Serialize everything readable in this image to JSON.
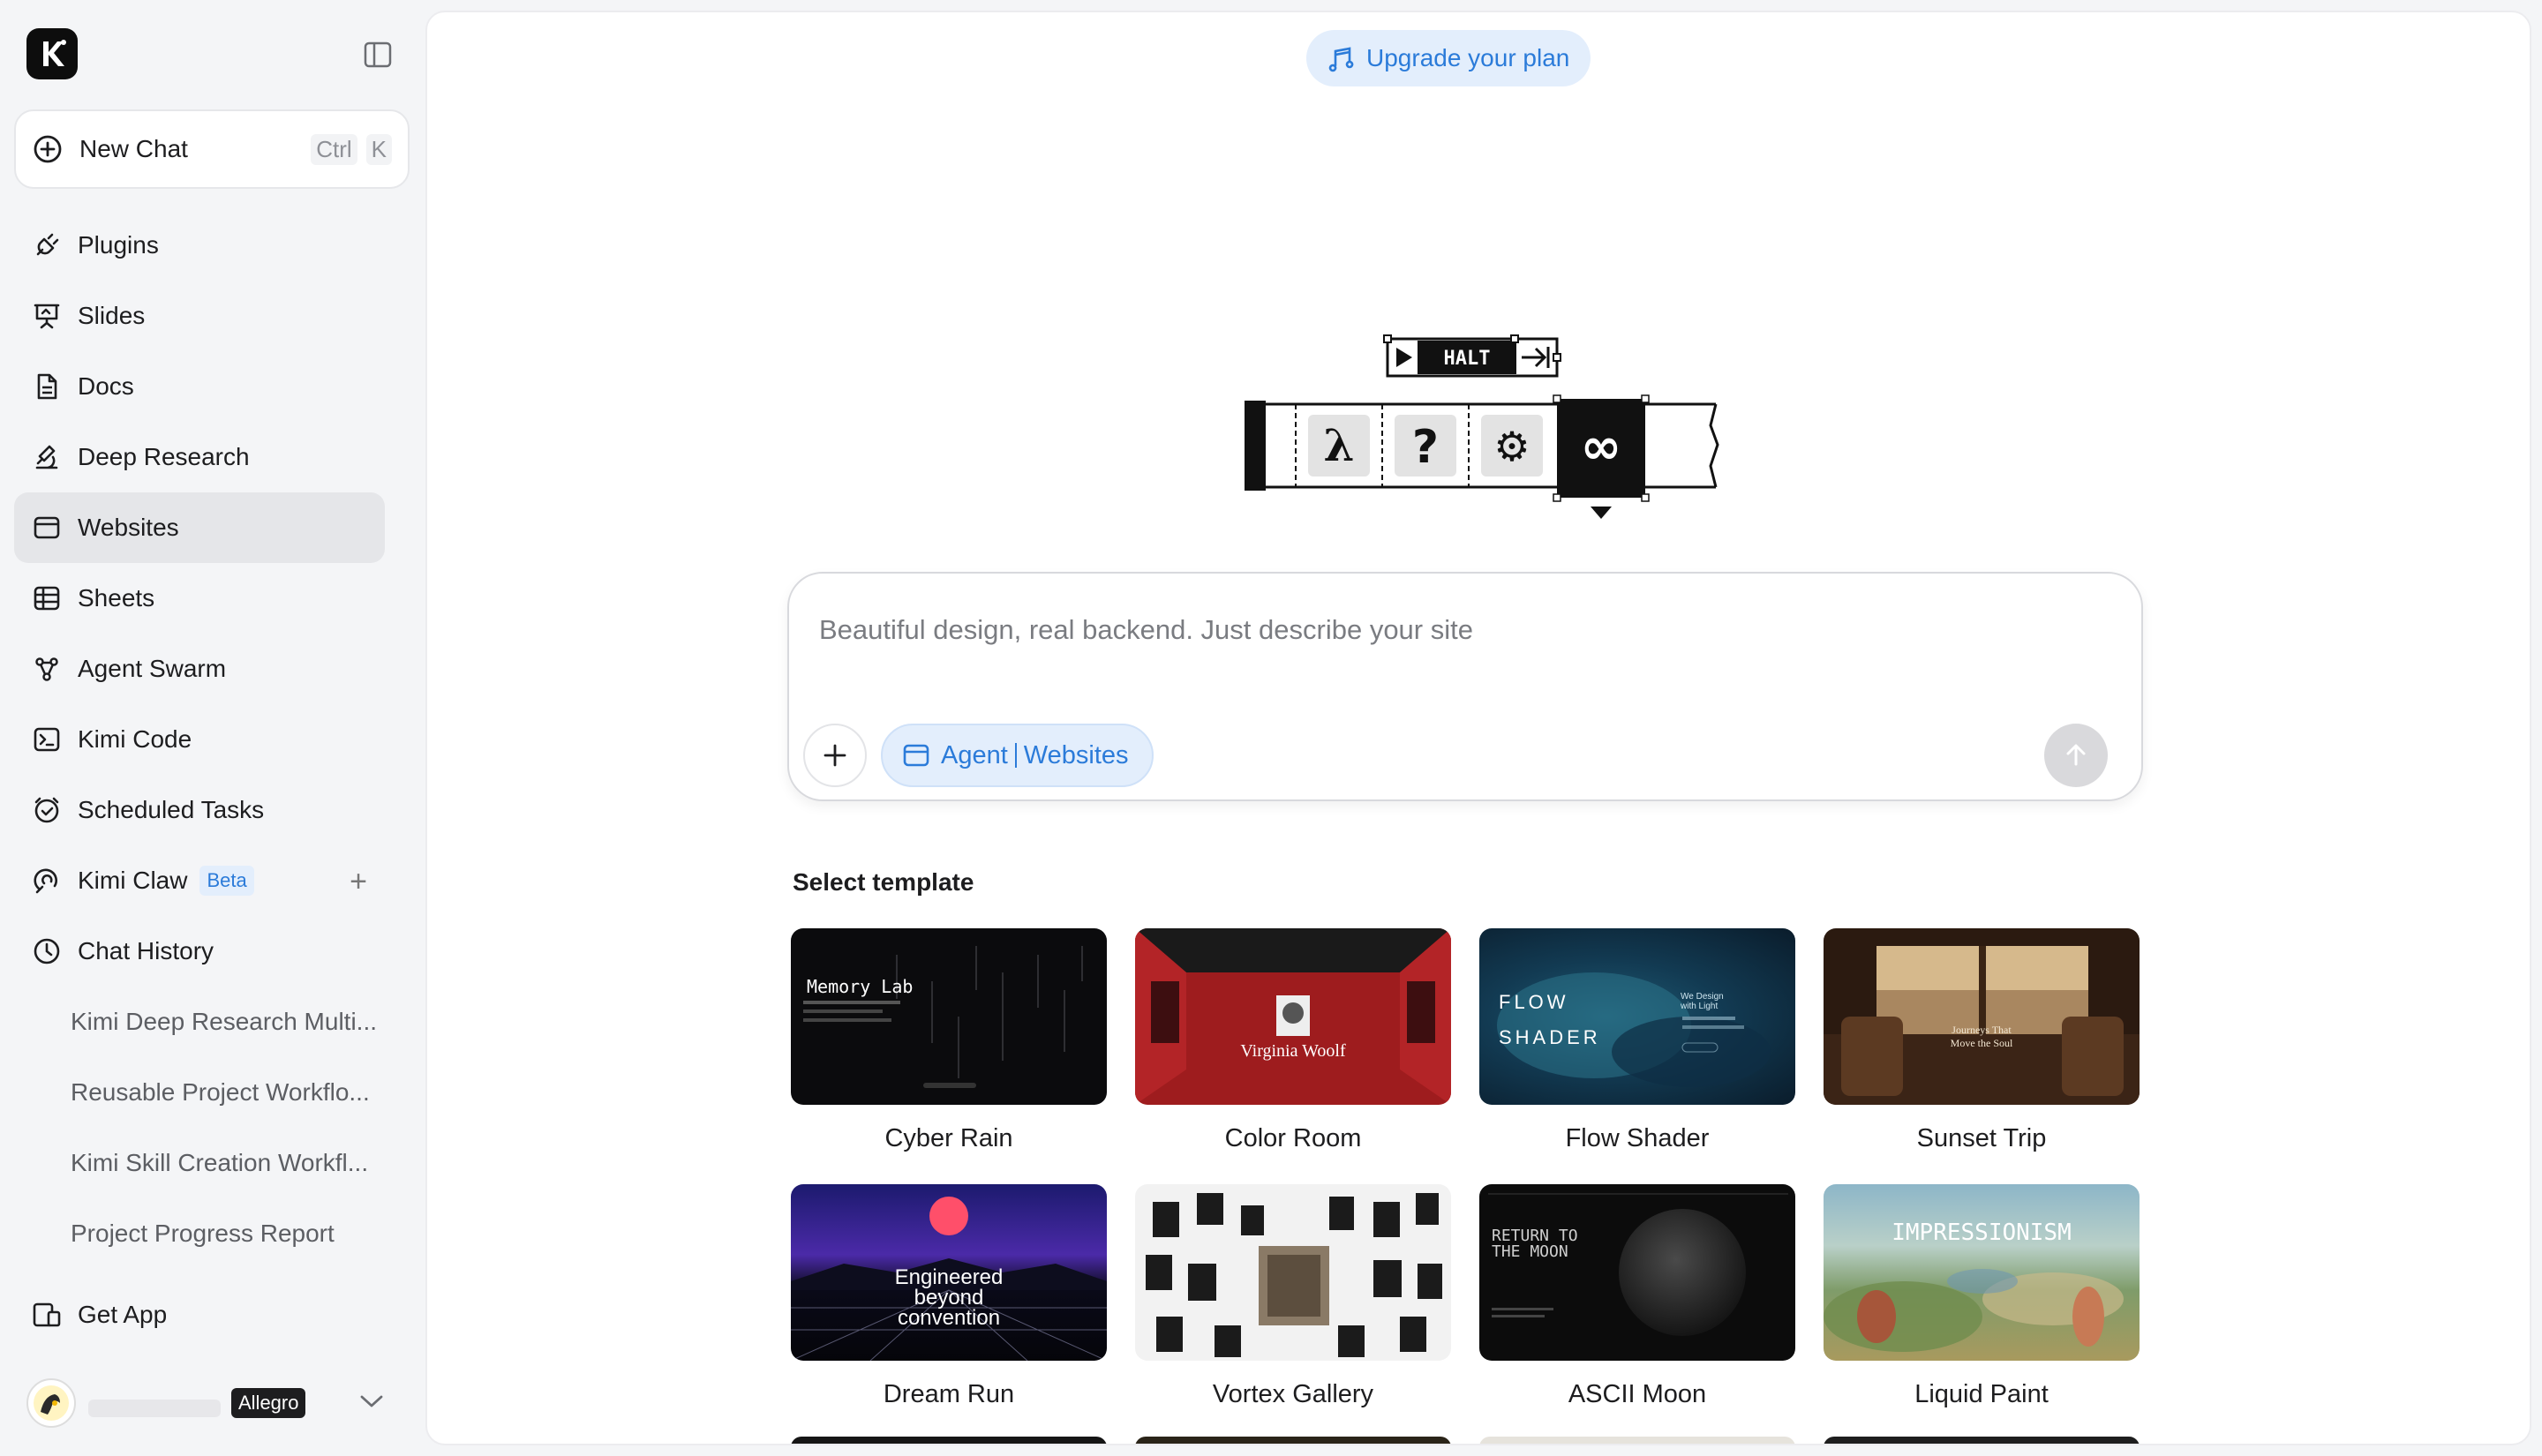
{
  "sidebar": {
    "logo_letter": "K",
    "new_chat": {
      "label": "New Chat",
      "shortcut": [
        "Ctrl",
        "K"
      ]
    },
    "items": [
      {
        "label": "Plugins",
        "icon": "plug-icon"
      },
      {
        "label": "Slides",
        "icon": "presentation-icon"
      },
      {
        "label": "Docs",
        "icon": "document-icon"
      },
      {
        "label": "Deep Research",
        "icon": "research-icon"
      },
      {
        "label": "Websites",
        "icon": "browser-icon",
        "active": true
      },
      {
        "label": "Sheets",
        "icon": "table-icon"
      },
      {
        "label": "Agent Swarm",
        "icon": "swarm-icon"
      },
      {
        "label": "Kimi Code",
        "icon": "terminal-icon"
      },
      {
        "label": "Scheduled Tasks",
        "icon": "clock-check-icon"
      },
      {
        "label": "Kimi Claw",
        "icon": "claw-icon",
        "badge": "Beta"
      },
      {
        "label": "Chat History",
        "icon": "history-icon"
      }
    ],
    "history": [
      "Kimi Deep Research Multi...",
      "Reusable Project Workflo...",
      "Kimi Skill Creation Workfl...",
      "Project Progress Report"
    ],
    "get_app": "Get App",
    "user": {
      "plan": "Allegro"
    }
  },
  "main": {
    "upgrade_label": "Upgrade your plan",
    "hero": {
      "halt": "HALT"
    },
    "prompt": {
      "placeholder": "Beautiful design, real backend. Just describe your site",
      "chip_agent": "Agent",
      "chip_mode": "Websites"
    },
    "templates_title": "Select template",
    "templates": [
      {
        "name": "Cyber Rain",
        "thumb_text": "Memory Lab"
      },
      {
        "name": "Color Room",
        "thumb_text": "Virginia Woolf"
      },
      {
        "name": "Flow Shader",
        "thumb_text": "FLOW SHADER",
        "thumb_sub": "We Design with Light"
      },
      {
        "name": "Sunset Trip",
        "thumb_text": "Journeys That Move the Soul"
      },
      {
        "name": "Dream Run",
        "thumb_text": "Engineered beyond convention"
      },
      {
        "name": "Vortex Gallery",
        "thumb_text": ""
      },
      {
        "name": "ASCII Moon",
        "thumb_text": "RETURN TO THE MOON"
      },
      {
        "name": "Liquid Paint",
        "thumb_text": "IMPRESSIONISM"
      }
    ]
  },
  "colors": {
    "accent": "#2b7bd9",
    "accent_bg": "#e3eefc",
    "sidebar_bg": "#f4f5f7",
    "active_item": "#e5e6e9"
  }
}
